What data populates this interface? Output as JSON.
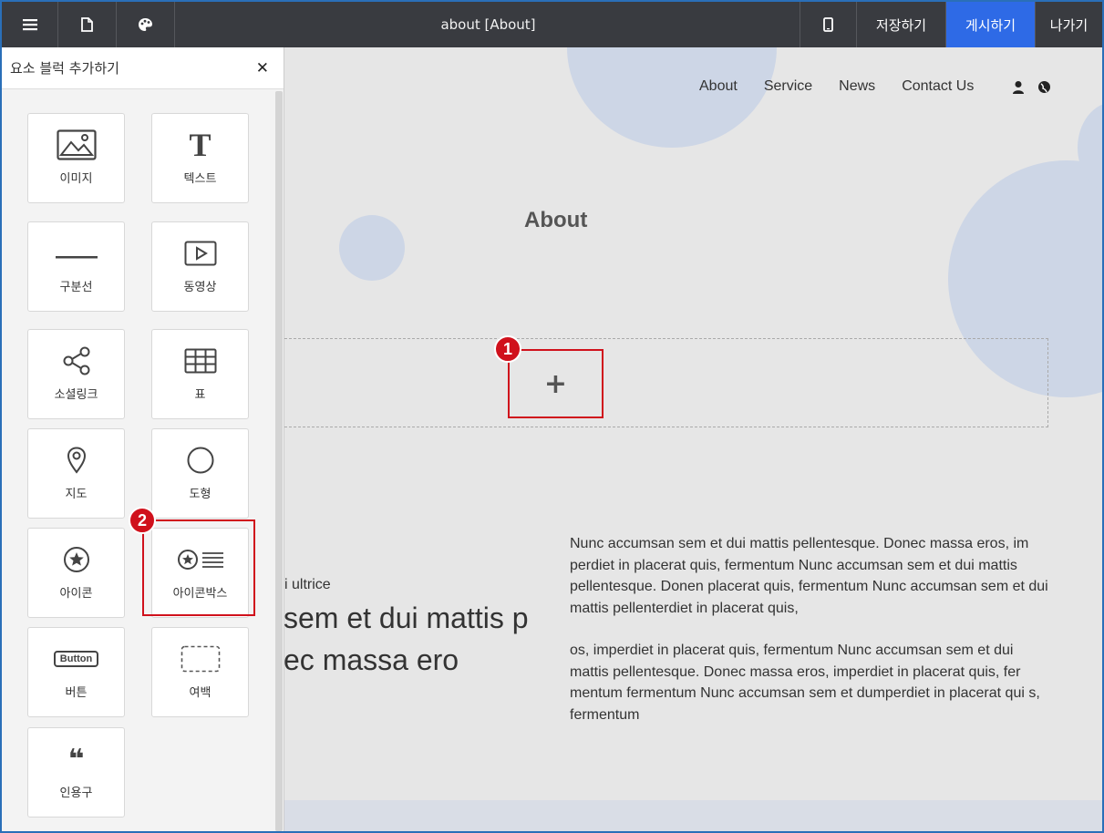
{
  "topbar": {
    "title": "about [About]",
    "save": "저장하기",
    "publish": "게시하기",
    "exit": "나가기",
    "colors": {
      "bar": "#393b40",
      "publish": "#2e6ae6"
    }
  },
  "panel": {
    "title": "요소 블럭 추가하기",
    "close": "✕",
    "tiles": [
      {
        "label": "이미지",
        "icon": "image-icon"
      },
      {
        "label": "텍스트",
        "icon": "text-icon"
      },
      {
        "label": "구분선",
        "icon": "divider-icon"
      },
      {
        "label": "동영상",
        "icon": "video-icon"
      },
      {
        "label": "소셜링크",
        "icon": "share-icon"
      },
      {
        "label": "표",
        "icon": "table-icon"
      },
      {
        "label": "지도",
        "icon": "map-pin-icon"
      },
      {
        "label": "도형",
        "icon": "circle-shape-icon"
      },
      {
        "label": "아이콘",
        "icon": "star-circle-icon"
      },
      {
        "label": "아이콘박스",
        "icon": "iconbox-icon"
      },
      {
        "label": "버튼",
        "icon": "button-icon"
      },
      {
        "label": "여백",
        "icon": "spacer-icon"
      },
      {
        "label": "인용구",
        "icon": "quote-icon"
      }
    ],
    "button_icon_text": "Button",
    "text_icon_glyph": "T",
    "quote_glyph": "❝"
  },
  "site": {
    "nav": [
      "About",
      "Service",
      "News",
      "Contact Us"
    ],
    "heading": "About",
    "add_symbol": "+",
    "small_line": "i ultrice",
    "big_line_1": "sem et dui mattis p",
    "big_line_2": "ec massa ero",
    "paragraph_1": "Nunc accumsan sem et dui mattis pellentesque. Donec massa eros, im perdiet in placerat quis, fermentum Nunc accumsan sem et dui mattis pellentesque. Donen placerat quis, fermentum Nunc accumsan sem et dui mattis pellenterdiet in placerat quis,",
    "paragraph_2": " os, imperdiet in placerat quis, fermentum Nunc accumsan sem et dui mattis pellentesque. Donec massa eros, imperdiet in placerat quis, fer mentum fermentum Nunc accumsan sem et dumperdiet in placerat qui s, fermentum"
  },
  "callouts": {
    "one": "1",
    "two": "2",
    "color": "#d0111c"
  }
}
